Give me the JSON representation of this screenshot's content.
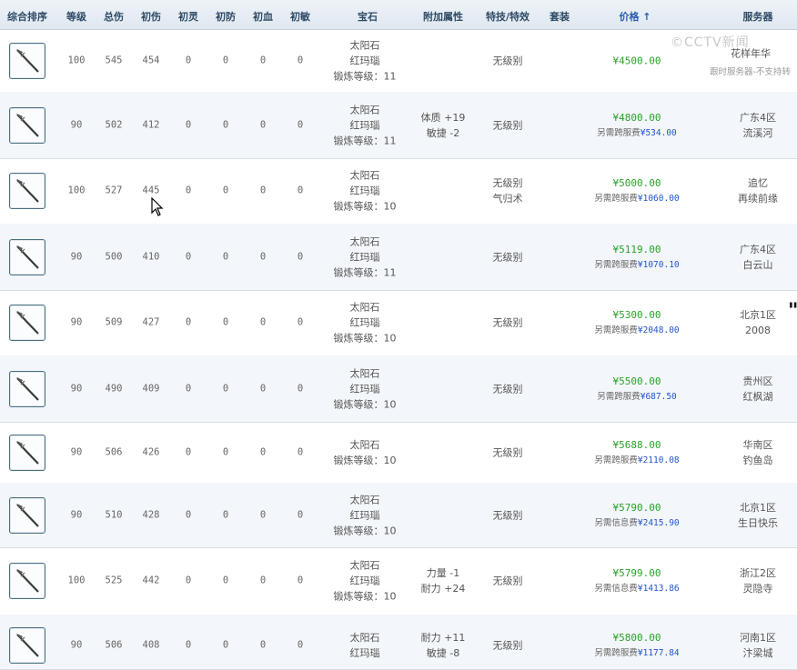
{
  "header": {
    "cols": [
      "综合排序",
      "等级",
      "总伤",
      "初伤",
      "初灵",
      "初防",
      "初血",
      "初敏",
      "宝石",
      "附加属性",
      "特技/特效",
      "套装",
      "价格 ↑",
      "服务器"
    ]
  },
  "watermark": "©CCTV新闻",
  "rows": [
    {
      "level": "100",
      "total": "545",
      "init": "454",
      "ling": "0",
      "fang": "0",
      "xue": "0",
      "min": "0",
      "gems": [
        "太阳石",
        "红玛瑙",
        "锻炼等级：11"
      ],
      "attrs": [],
      "skill": [
        "无级别"
      ],
      "price": "¥4500.00",
      "fee_label": "",
      "fee_value": "",
      "server": [
        "花样年华"
      ],
      "server_note": "跟时服务器-不支持转"
    },
    {
      "level": "90",
      "total": "502",
      "init": "412",
      "ling": "0",
      "fang": "0",
      "xue": "0",
      "min": "0",
      "gems": [
        "太阳石",
        "红玛瑙",
        "锻炼等级：11"
      ],
      "attrs": [
        "体质 +19",
        "敏捷 -2"
      ],
      "skill": [
        "无级别"
      ],
      "price": "¥4800.00",
      "fee_label": "另需跨服费",
      "fee_value": "¥534.00",
      "server": [
        "广东4区",
        "流溪河"
      ]
    },
    {
      "level": "100",
      "total": "527",
      "init": "445",
      "ling": "0",
      "fang": "0",
      "xue": "0",
      "min": "0",
      "gems": [
        "太阳石",
        "红玛瑙",
        "锻炼等级：10"
      ],
      "attrs": [],
      "skill": [
        "无级别",
        "气归术"
      ],
      "price": "¥5000.00",
      "fee_label": "另需跨服费",
      "fee_value": "¥1060.00",
      "server": [
        "追忆",
        "再续前缘"
      ]
    },
    {
      "level": "90",
      "total": "500",
      "init": "410",
      "ling": "0",
      "fang": "0",
      "xue": "0",
      "min": "0",
      "gems": [
        "太阳石",
        "红玛瑙",
        "锻炼等级：11"
      ],
      "attrs": [],
      "skill": [
        "无级别"
      ],
      "price": "¥5119.00",
      "fee_label": "另需跨服费",
      "fee_value": "¥1070.10",
      "server": [
        "广东4区",
        "白云山"
      ]
    },
    {
      "level": "90",
      "total": "509",
      "init": "427",
      "ling": "0",
      "fang": "0",
      "xue": "0",
      "min": "0",
      "gems": [
        "太阳石",
        "红玛瑙",
        "锻炼等级：10"
      ],
      "attrs": [],
      "skill": [
        "无级别"
      ],
      "price": "¥5300.00",
      "fee_label": "另需跨服费",
      "fee_value": "¥2048.00",
      "server": [
        "北京1区",
        "2008"
      ]
    },
    {
      "level": "90",
      "total": "490",
      "init": "409",
      "ling": "0",
      "fang": "0",
      "xue": "0",
      "min": "0",
      "gems": [
        "太阳石",
        "红玛瑙",
        "锻炼等级：10"
      ],
      "attrs": [],
      "skill": [
        "无级别"
      ],
      "price": "¥5500.00",
      "fee_label": "另需跨服费",
      "fee_value": "¥687.50",
      "server": [
        "贵州区",
        "红枫湖"
      ]
    },
    {
      "level": "90",
      "total": "506",
      "init": "426",
      "ling": "0",
      "fang": "0",
      "xue": "0",
      "min": "0",
      "gems": [
        "太阳石",
        "锻炼等级：10"
      ],
      "attrs": [],
      "skill": [
        "无级别"
      ],
      "price": "¥5688.00",
      "fee_label": "另需跨服费",
      "fee_value": "¥2110.08",
      "server": [
        "华南区",
        "钓鱼岛"
      ]
    },
    {
      "level": "90",
      "total": "510",
      "init": "428",
      "ling": "0",
      "fang": "0",
      "xue": "0",
      "min": "0",
      "gems": [
        "太阳石",
        "红玛瑙",
        "锻炼等级：10"
      ],
      "attrs": [],
      "skill": [
        "无级别"
      ],
      "price": "¥5790.00",
      "fee_label": "另需信息费",
      "fee_value": "¥2415.90",
      "server": [
        "北京1区",
        "生日快乐"
      ]
    },
    {
      "level": "100",
      "total": "525",
      "init": "442",
      "ling": "0",
      "fang": "0",
      "xue": "0",
      "min": "0",
      "gems": [
        "太阳石",
        "红玛瑙",
        "锻炼等级：10"
      ],
      "attrs": [
        "力量 -1",
        "耐力 +24"
      ],
      "skill": [
        "无级别"
      ],
      "price": "¥5799.00",
      "fee_label": "另需信息费",
      "fee_value": "¥1413.86",
      "server": [
        "浙江2区",
        "灵隐寺"
      ]
    },
    {
      "level": "90",
      "total": "506",
      "init": "408",
      "ling": "0",
      "fang": "0",
      "xue": "0",
      "min": "0",
      "gems": [
        "太阳石",
        "红玛瑙"
      ],
      "attrs": [
        "耐力 +11",
        "敏捷 -8"
      ],
      "skill": [
        "无级别"
      ],
      "price": "¥5800.00",
      "fee_label": "另需跨服费",
      "fee_value": "¥1177.84",
      "server": [
        "河南1区",
        "汴梁城"
      ]
    }
  ]
}
